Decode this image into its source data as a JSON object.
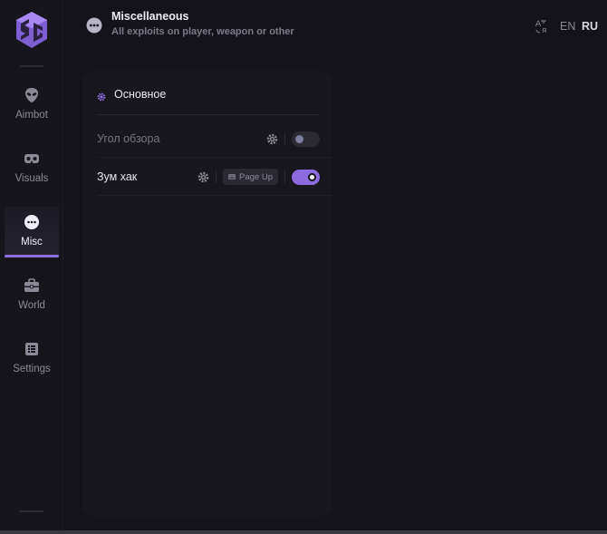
{
  "sidebar": {
    "items": [
      {
        "label": "Aimbot",
        "icon": "alien-icon"
      },
      {
        "label": "Visuals",
        "icon": "vr-goggles-icon"
      },
      {
        "label": "Misc",
        "icon": "dots-circle-icon",
        "active": true
      },
      {
        "label": "World",
        "icon": "toolbox-icon"
      },
      {
        "label": "Settings",
        "icon": "list-icon"
      }
    ]
  },
  "header": {
    "title": "Miscellaneous",
    "subtitle": "All exploits on player, weapon or other",
    "icon": "dots-circle-icon"
  },
  "language": {
    "icon": "translate-icon",
    "options": [
      "EN",
      "RU"
    ],
    "selected": "RU"
  },
  "panel": {
    "title": "Основное",
    "rows": [
      {
        "label": "Угол обзора",
        "enabled": false,
        "label_color": "#76757f"
      },
      {
        "label": "Зум хак",
        "keybind": "Page Up",
        "enabled": true,
        "label_color": "#e6e5ee"
      }
    ]
  },
  "colors": {
    "accent": "#8c6bdf",
    "background": "#141319",
    "panel": "#18171d"
  }
}
